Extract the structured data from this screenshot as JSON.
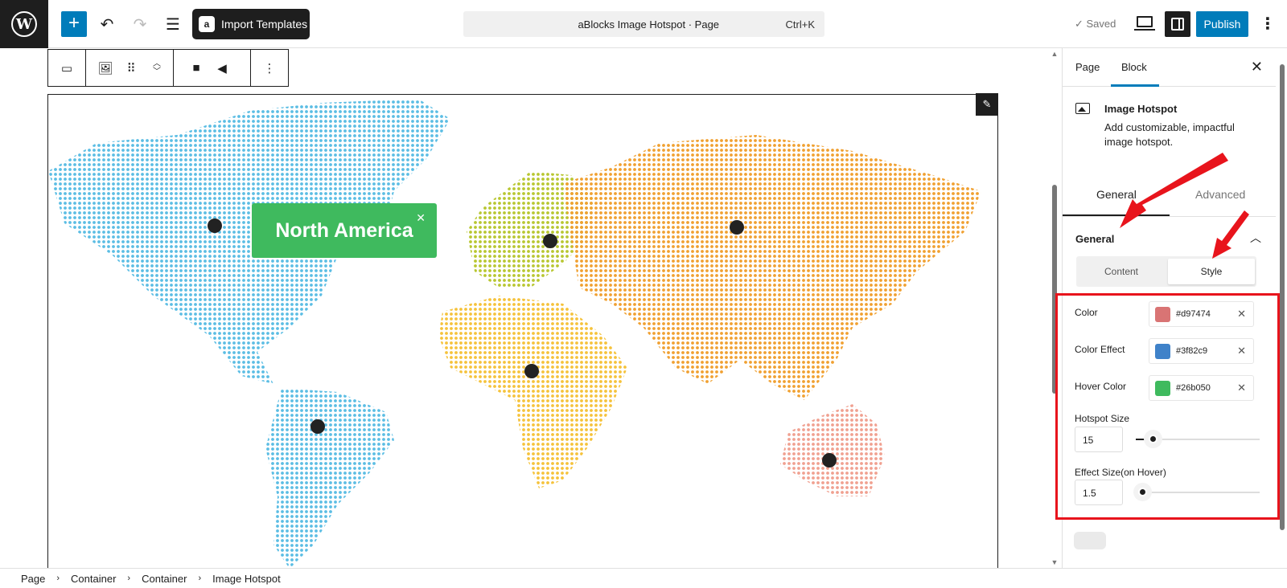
{
  "topbar": {
    "import_templates": "Import Templates",
    "command_title": "aBlocks Image Hotspot · Page",
    "command_shortcut": "Ctrl+K",
    "saved": "Saved",
    "publish": "Publish"
  },
  "popup": {
    "title": "North America"
  },
  "sidebar": {
    "tab_page": "Page",
    "tab_block": "Block",
    "block_name": "Image Hotspot",
    "block_desc": "Add customizable, impactful image hotspot.",
    "tab_general": "General",
    "tab_advanced": "Advanced",
    "panel_title": "General",
    "seg_content": "Content",
    "seg_style": "Style",
    "color_label": "Color",
    "color_value": "#d97474",
    "color_effect_label": "Color Effect",
    "color_effect_value": "#3f82c9",
    "hover_color_label": "Hover Color",
    "hover_color_value": "#26b050",
    "hotspot_size_label": "Hotspot Size",
    "hotspot_size_value": "15",
    "effect_size_label": "Effect Size(on Hover)",
    "effect_size_value": "1.5"
  },
  "breadcrumb": [
    "Page",
    "Container",
    "Container",
    "Image Hotspot"
  ],
  "colors": {
    "accent": "#007cba",
    "popup_green": "#3fba5e",
    "highlight_red": "#e8141c"
  }
}
